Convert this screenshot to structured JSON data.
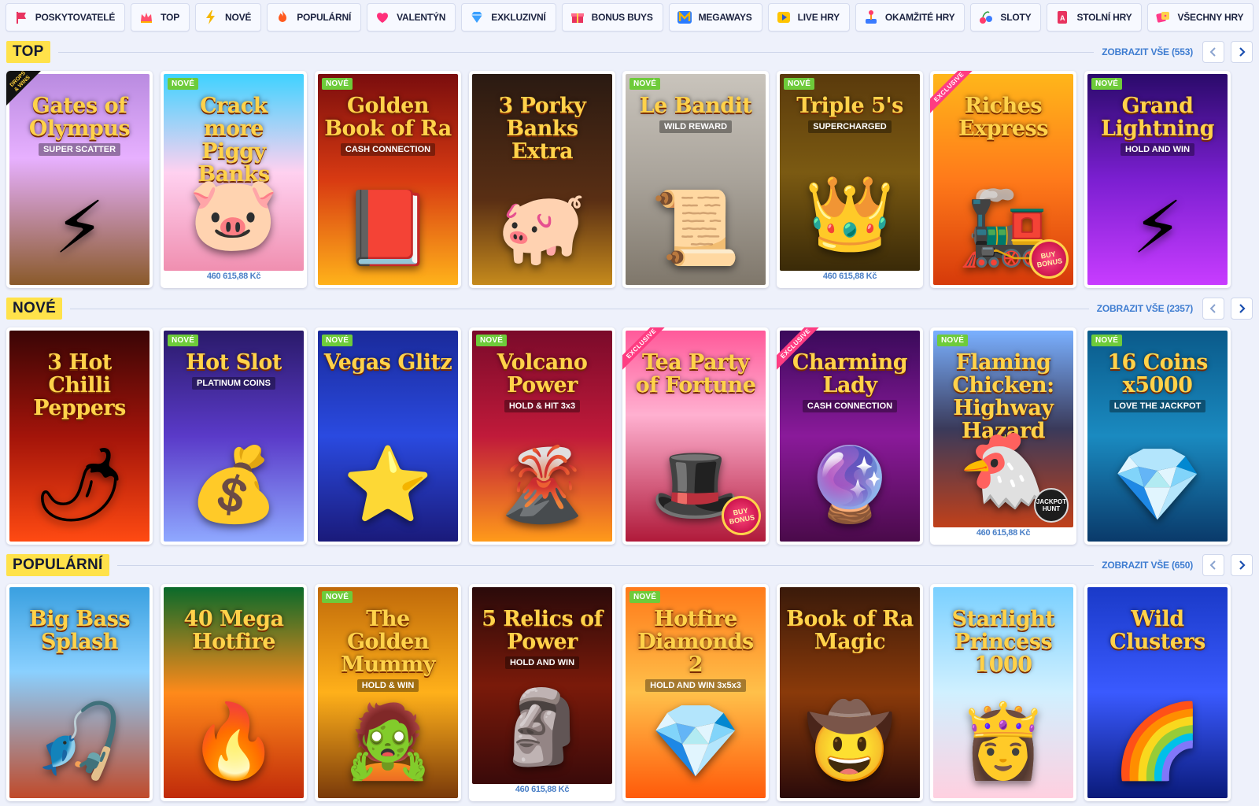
{
  "categories": [
    {
      "label": "POSKYTOVATELÉ",
      "icon": "provider-flag-icon",
      "color": "#e8335f"
    },
    {
      "label": "TOP",
      "icon": "crown-icon",
      "color": "#ff4f6e"
    },
    {
      "label": "NOVÉ",
      "icon": "lightning-icon",
      "color": "#f5b700"
    },
    {
      "label": "POPULÁRNÍ",
      "icon": "fire-icon",
      "color": "#ff5a1f"
    },
    {
      "label": "VALENTÝN",
      "icon": "heart-icon",
      "color": "#ff2f7a"
    },
    {
      "label": "EXKLUZIVNÍ",
      "icon": "diamond-icon",
      "color": "#3aa0ff"
    },
    {
      "label": "BONUS BUYS",
      "icon": "gift-icon",
      "color": "#e8335f"
    },
    {
      "label": "MEGAWAYS",
      "icon": "megaways-m-icon",
      "color": "#f3b400"
    },
    {
      "label": "LIVE HRY",
      "icon": "play-icon",
      "color": "#ffc400"
    },
    {
      "label": "OKAMŽITÉ HRY",
      "icon": "joystick-icon",
      "color": "#3b7bff"
    },
    {
      "label": "SLOTY",
      "icon": "slot-cherry-icon",
      "color": "#ff3b6b"
    },
    {
      "label": "STOLNÍ HRY",
      "icon": "card-icon",
      "color": "#e8335f"
    },
    {
      "label": "VŠECHNY HRY",
      "icon": "dice-icon",
      "color": "#ff3b8a"
    }
  ],
  "sections": [
    {
      "title": "TOP",
      "view_all": "ZOBRAZIT VŠE (553)",
      "games": [
        {
          "title": "Gates of Olympus",
          "subtitle": "SUPER SCATTER",
          "emblem": "⚡",
          "bg": "linear-gradient(180deg,#b98be0 0%,#e7b0ff 40%,#8a5a2a 100%)",
          "badge": "drops",
          "drops_text": "DROPS & WINS",
          "jackpot": null
        },
        {
          "title": "Crack more Piggy Banks",
          "subtitle": "",
          "emblem": "🐷",
          "bg": "linear-gradient(180deg,#3fd2ff 0%,#ffd1f0 50%,#f08fb0 100%)",
          "badge": "new",
          "badge_text": "NOVÉ",
          "jackpot": "460 615,88 Kč"
        },
        {
          "title": "Golden Book of Ra",
          "subtitle": "CASH CONNECTION",
          "emblem": "📕",
          "bg": "linear-gradient(180deg,#7a0d0d 0%,#d83a12 50%,#ffb21a 100%)",
          "badge": "new",
          "badge_text": "NOVÉ",
          "jackpot": null
        },
        {
          "title": "3 Porky Banks Extra",
          "subtitle": "",
          "emblem": "🐖",
          "bg": "linear-gradient(180deg,#2a1a12 0%,#5a2f14 60%,#c58a1c 100%)",
          "badge": null,
          "jackpot": null
        },
        {
          "title": "Le Bandit",
          "subtitle": "WILD REWARD",
          "emblem": "📜",
          "bg": "linear-gradient(180deg,#c9c4bc 0%,#a9a39a 50%,#7f776b 100%)",
          "badge": "new",
          "badge_text": "NOVÉ",
          "jackpot": null
        },
        {
          "title": "Triple 5's",
          "subtitle": "SUPERCHARGED",
          "emblem": "👑",
          "bg": "linear-gradient(180deg,#5a3a0c 0%,#7b5a12 50%,#3a2a08 100%)",
          "badge": "new",
          "badge_text": "NOVÉ",
          "jackpot": "460 615,88 Kč"
        },
        {
          "title": "Riches Express",
          "subtitle": "",
          "emblem": "🚂",
          "bg": "linear-gradient(180deg,#ffb61a 0%,#ff7a1a 50%,#d63a0a 100%)",
          "badge": "ex",
          "badge_text": "EXCLUSIVE",
          "buy_bonus": "BUY BONUS",
          "jackpot": null
        },
        {
          "title": "Grand Lightning",
          "subtitle": "HOLD AND WIN",
          "emblem": "⚡",
          "bg": "linear-gradient(180deg,#2a0a6a 0%,#7b1fd1 50%,#c83cff 100%)",
          "badge": "new",
          "badge_text": "NOVÉ",
          "jackpot": null
        }
      ]
    },
    {
      "title": "NOVÉ",
      "view_all": "ZOBRAZIT VŠE (2357)",
      "games": [
        {
          "title": "3 Hot Chilli Peppers",
          "subtitle": "",
          "emblem": "🌶",
          "bg": "linear-gradient(180deg,#3a0505 0%,#a3140a 50%,#ff4a12 100%)",
          "badge": null,
          "jackpot": null
        },
        {
          "title": "Hot Slot",
          "subtitle": "PLATINUM COINS",
          "emblem": "💰",
          "bg": "linear-gradient(180deg,#2a1a6a 0%,#5a3ac8 50%,#8fa8ff 100%)",
          "badge": "new",
          "badge_text": "NOVÉ",
          "jackpot": null
        },
        {
          "title": "Vegas Glitz",
          "subtitle": "",
          "emblem": "⭐",
          "bg": "linear-gradient(180deg,#1a2a9a 0%,#2a4ae0 50%,#1a1a7a 100%)",
          "badge": "new",
          "badge_text": "NOVÉ",
          "jackpot": null
        },
        {
          "title": "Volcano Power",
          "subtitle": "HOLD & HIT 3x3",
          "emblem": "🌋",
          "bg": "linear-gradient(180deg,#7a0a2a 0%,#c01a3a 50%,#ff9a1a 100%)",
          "badge": "new",
          "badge_text": "NOVÉ",
          "jackpot": null
        },
        {
          "title": "Tea Party of Fortune",
          "subtitle": "",
          "emblem": "🎩",
          "bg": "linear-gradient(180deg,#ff5a9a 0%,#ffb0d0 40%,#b01a3a 100%)",
          "badge": "ex",
          "badge_text": "EXCLUSIVE",
          "buy_bonus": "BUY BONUS",
          "jackpot": null
        },
        {
          "title": "Charming Lady",
          "subtitle": "CASH CONNECTION",
          "emblem": "🔮",
          "bg": "linear-gradient(180deg,#3a0a5a 0%,#8a1a9a 50%,#4a0a4a 100%)",
          "badge": "ex",
          "badge_text": "EXCLUSIVE",
          "jackpot": null
        },
        {
          "title": "Flaming Chicken: Highway Hazard",
          "subtitle": "",
          "emblem": "🐔",
          "bg": "linear-gradient(180deg,#7ab0ff 0%,#3a3a5a 50%,#c0401a 100%)",
          "badge": "new",
          "badge_text": "NOVÉ",
          "jackpot_hunt": "JACKPOT HUNT",
          "jackpot": "460 615,88 Kč"
        },
        {
          "title": "16 Coins x5000",
          "subtitle": "LOVE THE JACKPOT",
          "emblem": "💎",
          "bg": "linear-gradient(180deg,#0a5a8a 0%,#1a8ac0 50%,#0a3a6a 100%)",
          "badge": "new",
          "badge_text": "NOVÉ",
          "jackpot": null
        }
      ]
    },
    {
      "title": "POPULÁRNÍ",
      "view_all": "ZOBRAZIT VŠE (650)",
      "games": [
        {
          "title": "Big Bass Splash",
          "subtitle": "",
          "emblem": "🎣",
          "bg": "linear-gradient(180deg,#3aa0e0 0%,#8ad0ff 40%,#c04a2a 100%)",
          "badge": null,
          "jackpot": null
        },
        {
          "title": "40 Mega Hotfire",
          "subtitle": "",
          "emblem": "🔥",
          "bg": "linear-gradient(180deg,#0a6a2a 0%,#ff8a1a 50%,#c02a0a 100%)",
          "badge": null,
          "jackpot": null
        },
        {
          "title": "The Golden Mummy",
          "subtitle": "HOLD & WIN",
          "emblem": "🧟",
          "bg": "linear-gradient(180deg,#c06a0a 0%,#ffb01a 50%,#7a3a0a 100%)",
          "badge": "new",
          "badge_text": "NOVÉ",
          "jackpot": null
        },
        {
          "title": "5 Relics of Power",
          "subtitle": "HOLD AND WIN",
          "emblem": "🗿",
          "bg": "linear-gradient(180deg,#2a0a0a 0%,#7a1a0a 50%,#3a0a0a 100%)",
          "badge": null,
          "jackpot": "460 615,88 Kč"
        },
        {
          "title": "Hotfire Diamonds 2",
          "subtitle": "HOLD AND WIN 3x5x3",
          "emblem": "💎",
          "bg": "linear-gradient(180deg,#ff7a1a 0%,#ffc04a 50%,#ff5a0a 100%)",
          "badge": "new",
          "badge_text": "NOVÉ",
          "jackpot": null
        },
        {
          "title": "Book of Ra Magic",
          "subtitle": "",
          "emblem": "🤠",
          "bg": "linear-gradient(180deg,#3a1a0a 0%,#8a3a0a 50%,#2a0a0a 100%)",
          "badge": null,
          "jackpot": null
        },
        {
          "title": "Starlight Princess 1000",
          "subtitle": "",
          "emblem": "👸",
          "bg": "linear-gradient(180deg,#7ad0ff 0%,#d0f0ff 50%,#ffd0e0 100%)",
          "badge": null,
          "jackpot": null
        },
        {
          "title": "Wild Clusters",
          "subtitle": "",
          "emblem": "🌈",
          "bg": "linear-gradient(180deg,#1a3ac8 0%,#3a5aff 50%,#0a1a7a 100%)",
          "badge": null,
          "jackpot": null
        }
      ]
    }
  ]
}
